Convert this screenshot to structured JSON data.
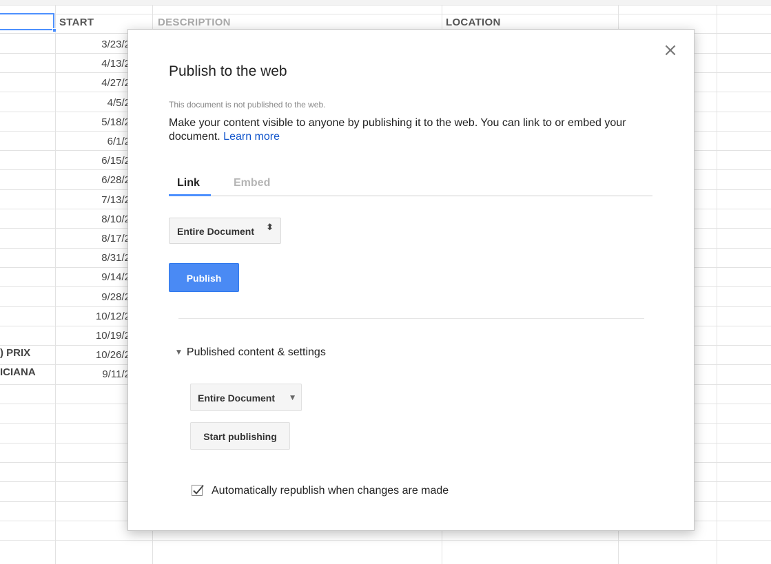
{
  "sheet": {
    "columns": [
      "START",
      "DESCRIPTION",
      "LOCATION"
    ],
    "dates": [
      "3/23/2",
      "4/13/2",
      "4/27/2",
      "4/5/2",
      "5/18/2",
      "6/1/2",
      "6/15/2",
      "6/28/2",
      "7/13/2",
      "8/10/2",
      "8/17/2",
      "8/31/2",
      "9/14/2",
      "9/28/2",
      "10/12/2",
      "10/19/2",
      "10/26/2",
      "9/11/2"
    ],
    "left_cells": [
      ") PRIX",
      "ICIANA"
    ]
  },
  "dialog": {
    "close_icon": "×",
    "title": "Publish to the web",
    "note": "This document is not published to the web.",
    "description": "Make your content visible to anyone by publishing it to the web. You can link to or embed your document.",
    "learn_more": "Learn more",
    "tabs": {
      "link": "Link",
      "embed": "Embed"
    },
    "select_label": "Entire Document",
    "select_icon": "⬍",
    "publish_label": "Publish",
    "settings_label": "Published content & settings",
    "settings_icon": "▼",
    "scope_label": "Entire Document",
    "scope_icon": "▼",
    "start_label": "Start publishing",
    "auto_label": "Automatically republish when changes are made",
    "auto_checked": true
  },
  "colors": {
    "accent": "#4d90fe",
    "publish_button": "#4a8af4",
    "link": "#1155cc"
  }
}
